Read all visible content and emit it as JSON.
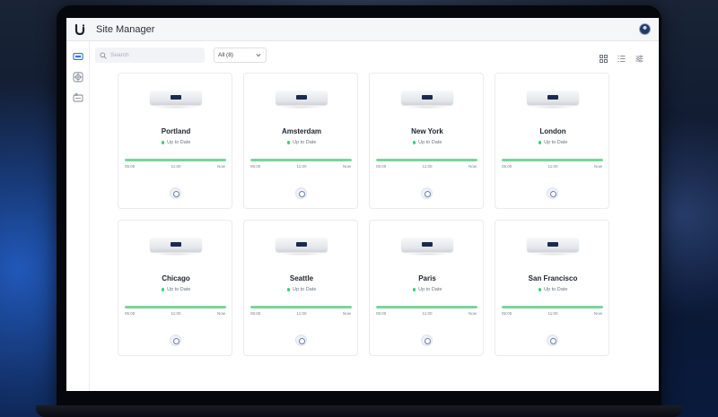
{
  "app": {
    "title": "Site Manager"
  },
  "toolbar": {
    "search_placeholder": "Search",
    "filter_label": "All (8)"
  },
  "sites": [
    {
      "name": "Portland",
      "status": "Up to Date",
      "uptime": 1.0
    },
    {
      "name": "Amsterdam",
      "status": "Up to Date",
      "uptime": 1.0
    },
    {
      "name": "New York",
      "status": "Up to Date",
      "uptime": 1.0
    },
    {
      "name": "London",
      "status": "Up to Date",
      "uptime": 1.0
    },
    {
      "name": "Chicago",
      "status": "Up to Date",
      "uptime": 1.0
    },
    {
      "name": "Seattle",
      "status": "Up to Date",
      "uptime": 1.0
    },
    {
      "name": "Paris",
      "status": "Up to Date",
      "uptime": 1.0
    },
    {
      "name": "San Francisco",
      "status": "Up to Date",
      "uptime": 1.0
    }
  ],
  "timeline_ticks": [
    "05:00",
    "11:00",
    "Now"
  ],
  "colors": {
    "status_ok": "#3ccf7a",
    "uptime_bar": "#78d59a",
    "brand": "#1b2a4e"
  },
  "icons": {
    "logo": "ubiquiti-logo-icon",
    "sidebar": [
      "sites-icon",
      "target-icon",
      "devices-icon"
    ],
    "views": [
      "grid-view-icon",
      "list-view-icon",
      "filter-settings-icon"
    ]
  }
}
